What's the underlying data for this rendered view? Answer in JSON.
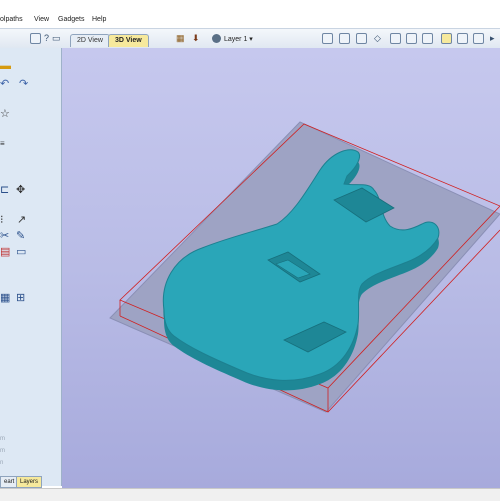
{
  "menu": {
    "toolpaths": "olpaths",
    "view": "View",
    "gadgets": "Gadgets",
    "help": "Help"
  },
  "toolbar": {
    "tab_2d": "2D View",
    "tab_3d": "3D View",
    "layer": "Layer 1 ▾",
    "help_glyph": "?"
  },
  "left_panel": {
    "faded_1": "m",
    "faded_2": "m",
    "faded_3": "n"
  },
  "bottom_tabs": {
    "left_tab": "eart",
    "layers_tab": "Layers"
  },
  "colors": {
    "viewport_top": "#c6c8ee",
    "viewport_bottom": "#a7aadc",
    "guitar_body": "#2aa6b8",
    "bounding_box": "#d02020",
    "stock_sheet": "#9ea3c4",
    "active_tab": "#f6e99c"
  },
  "icons": [
    "folder-icon",
    "undo-icon",
    "redo-icon",
    "star-icon",
    "node-edit-icon",
    "move-icon",
    "scissors-icon",
    "measure-icon",
    "gear-icon",
    "view-top-icon",
    "view-iso-icon",
    "grid-icon",
    "zoom-icon"
  ]
}
